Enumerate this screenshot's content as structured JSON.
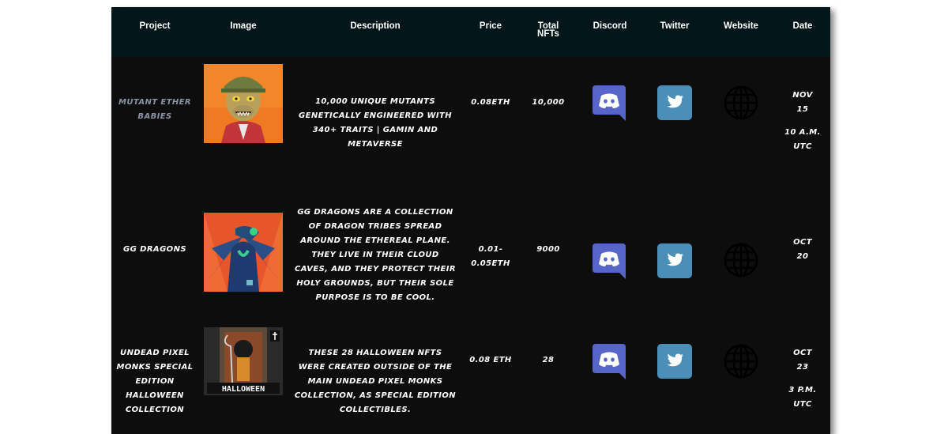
{
  "table": {
    "headers": {
      "project": "Project",
      "image": "Image",
      "description": "Description",
      "price": "Price",
      "total_nfts_line1": "Total",
      "total_nfts_line2": "NFTs",
      "discord": "Discord",
      "twitter": "Twitter",
      "website": "Website",
      "date": "Date"
    },
    "rows": [
      {
        "project": "Mutant Ether Babies",
        "description": "10,000 unique mutants genetically engineered with 340+ traits | gamin and metaverse",
        "price": "0.08ETH",
        "total": "10,000",
        "date_line1": "Nov 15",
        "date_line2": "10 A.M. UTC",
        "image_icon": "mutant-ape-image",
        "discord_icon": "discord-icon",
        "twitter_icon": "twitter-icon",
        "website_icon": "globe-icon"
      },
      {
        "project": "GG Dragons",
        "description": "GG Dragons are a collection of dragon tribes spread around the ethereal plane. They live in their cloud caves, and they protect their holy grounds, but their sole purpose is to be cool.",
        "price": "0.01- 0.05ETH",
        "total": "9000",
        "date_line1": "Oct 20",
        "image_icon": "dragon-image",
        "discord_icon": "discord-icon",
        "twitter_icon": "twitter-icon",
        "website_icon": "globe-icon"
      },
      {
        "project": "Undead Pixel Monks Special Edition Halloween Collection",
        "description": "These 28 Halloween NFTs were created outside of the main Undead Pixel Monks collection, as special edition collectibles.",
        "price": "0.08 ETH",
        "total": "28",
        "date_line1": "Oct 23",
        "date_line2": "3 P.M. UTC",
        "image_label": "HALLOWEEN",
        "image_icon": "reaper-image",
        "discord_icon": "discord-icon",
        "twitter_icon": "twitter-icon",
        "website_icon": "globe-icon"
      }
    ]
  },
  "colors": {
    "table_bg": "#0d0d0d",
    "header_bg": "#03171a",
    "discord": "#5865c8",
    "twitter": "#4a8fb8",
    "muted_project": "#8b93a3"
  }
}
